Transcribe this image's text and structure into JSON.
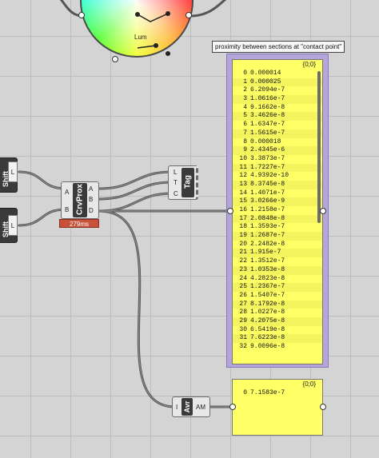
{
  "wheel": {
    "label": "Lum"
  },
  "inputs": {
    "upper_label": "Shift",
    "lower_label": "Shift",
    "port_label": "L"
  },
  "crvprox": {
    "name": "CrvProx",
    "inputs": [
      "A",
      "B"
    ],
    "outputs": [
      "A",
      "B",
      "D"
    ],
    "timer": "279ms"
  },
  "tag": {
    "name": "Tag",
    "inputs": [
      "L",
      "T",
      "C"
    ]
  },
  "avr": {
    "name": "Avr",
    "input": "I",
    "output": "AM"
  },
  "tooltip": "proximity between sections at \"contact point\"",
  "panel_main": {
    "path": "{0;0}",
    "rows": [
      {
        "i": "0",
        "v": "0.000014"
      },
      {
        "i": "1",
        "v": "0.000025"
      },
      {
        "i": "2",
        "v": "6.2094e-7"
      },
      {
        "i": "3",
        "v": "1.0616e-7"
      },
      {
        "i": "4",
        "v": "9.1662e-8"
      },
      {
        "i": "5",
        "v": "3.4626e-8"
      },
      {
        "i": "6",
        "v": "1.6347e-7"
      },
      {
        "i": "7",
        "v": "1.5615e-7"
      },
      {
        "i": "8",
        "v": "0.000018"
      },
      {
        "i": "9",
        "v": "2.4345e-6"
      },
      {
        "i": "10",
        "v": "3.3873e-7"
      },
      {
        "i": "11",
        "v": "1.7227e-7"
      },
      {
        "i": "12",
        "v": "4.9392e-10"
      },
      {
        "i": "13",
        "v": "8.3745e-8"
      },
      {
        "i": "14",
        "v": "1.4071e-7"
      },
      {
        "i": "15",
        "v": "3.0266e-9"
      },
      {
        "i": "16",
        "v": "1.2158e-7"
      },
      {
        "i": "17",
        "v": "2.0848e-8"
      },
      {
        "i": "18",
        "v": "1.3593e-7"
      },
      {
        "i": "19",
        "v": "1.2687e-7"
      },
      {
        "i": "20",
        "v": "2.2482e-8"
      },
      {
        "i": "21",
        "v": "1.915e-7"
      },
      {
        "i": "22",
        "v": "1.3512e-7"
      },
      {
        "i": "23",
        "v": "1.0353e-8"
      },
      {
        "i": "24",
        "v": "4.2823e-8"
      },
      {
        "i": "25",
        "v": "1.2367e-7"
      },
      {
        "i": "26",
        "v": "1.5407e-7"
      },
      {
        "i": "27",
        "v": "8.1792e-8"
      },
      {
        "i": "28",
        "v": "1.0227e-8"
      },
      {
        "i": "29",
        "v": "4.2075e-8"
      },
      {
        "i": "30",
        "v": "6.5419e-8"
      },
      {
        "i": "31",
        "v": "7.6223e-8"
      },
      {
        "i": "32",
        "v": "9.0096e-8"
      }
    ]
  },
  "panel_avg": {
    "path": "{0;0}",
    "rows": [
      {
        "i": "0",
        "v": "7.1583e-7"
      }
    ]
  }
}
